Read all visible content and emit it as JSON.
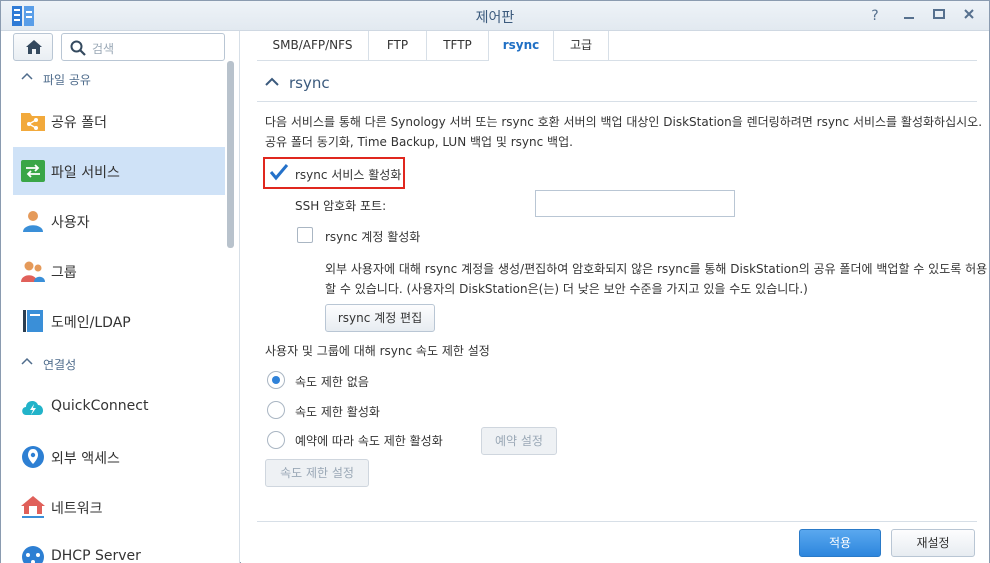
{
  "window": {
    "title": "제어판"
  },
  "sidebar": {
    "search_placeholder": "검색",
    "groups": [
      {
        "label": "파일 공유"
      },
      {
        "label": "연결성"
      }
    ],
    "items": [
      {
        "label": "공유 폴더",
        "icon": "shared-folder-icon"
      },
      {
        "label": "파일 서비스",
        "icon": "file-services-icon",
        "active": true
      },
      {
        "label": "사용자",
        "icon": "user-icon"
      },
      {
        "label": "그룹",
        "icon": "group-icon"
      },
      {
        "label": "도메인/LDAP",
        "icon": "domain-ldap-icon"
      },
      {
        "label": "QuickConnect",
        "icon": "quickconnect-icon"
      },
      {
        "label": "외부 액세스",
        "icon": "external-access-icon"
      },
      {
        "label": "네트워크",
        "icon": "network-icon"
      },
      {
        "label": "DHCP Server",
        "icon": "dhcp-server-icon"
      }
    ]
  },
  "tabs": [
    {
      "label": "SMB/AFP/NFS"
    },
    {
      "label": "FTP"
    },
    {
      "label": "TFTP"
    },
    {
      "label": "rsync",
      "active": true
    },
    {
      "label": "고급"
    }
  ],
  "section": {
    "title": "rsync",
    "desc_line1": "다음 서비스를 통해 다른 Synology 서버 또는 rsync 호환 서버의 백업 대상인 DiskStation을 렌더링하려면 rsync 서비스를 활성화하십시오.",
    "desc_line2": "공유 폴더 동기화, Time Backup, LUN 백업 및 rsync 백업.",
    "enable_rsync_label": "rsync 서비스 활성화",
    "enable_rsync_checked": true,
    "ssh_port_label": "SSH 암호화 포트:",
    "ssh_port_value": "",
    "enable_account_label": "rsync 계정 활성화",
    "enable_account_checked": false,
    "account_desc_line1": "외부 사용자에 대해 rsync 계정을 생성/편집하여 암호화되지 않은 rsync를 통해 DiskStation의 공유 폴더에 백업할 수 있도록 허용",
    "account_desc_line2": "할 수 있습니다. (사용자의 DiskStation은(는) 더 낮은 보안 수준을 가지고 있을 수도 있습니다.)",
    "edit_account_button": "rsync 계정 편집",
    "speed_heading": "사용자 및 그룹에 대해 rsync 속도 제한 설정",
    "radio_no_limit": "속도 제한 없음",
    "radio_enable_limit": "속도 제한 활성화",
    "radio_schedule_limit": "예약에 따라 속도 제한 활성화",
    "schedule_button": "예약 설정",
    "speed_settings_button": "속도 제한 설정"
  },
  "footer": {
    "apply_button": "적용",
    "reset_button": "재설정"
  },
  "colors": {
    "accent": "#2d86dd",
    "highlight_border": "#e0271e",
    "active_item_bg": "#cfe2f7"
  }
}
